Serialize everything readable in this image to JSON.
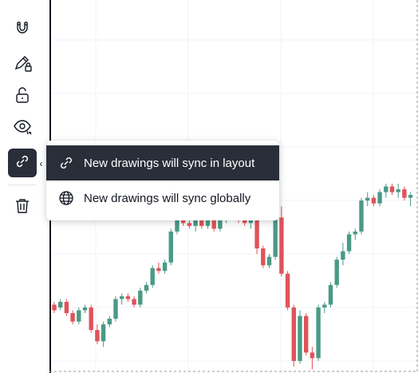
{
  "toolbar": {
    "tools": [
      {
        "name": "magnet-tool",
        "icon": "magnet-icon"
      },
      {
        "name": "lock-drawing-tool",
        "icon": "pencil-lock-icon"
      },
      {
        "name": "lock-all-tool",
        "icon": "unlock-icon"
      },
      {
        "name": "hide-drawings-tool",
        "icon": "eye-icon"
      },
      {
        "name": "sync-drawings-tool",
        "icon": "link-icon",
        "active": true
      },
      {
        "name": "remove-drawings-tool",
        "icon": "trash-icon"
      }
    ],
    "expand_glyph": "‹"
  },
  "sync_menu": {
    "items": [
      {
        "label": "New drawings will sync in layout",
        "icon": "link-icon",
        "selected": true
      },
      {
        "label": "New drawings will sync globally",
        "icon": "globe-icon",
        "selected": false
      }
    ]
  },
  "colors": {
    "up": "#4a9a86",
    "down": "#e0535b",
    "accent_dark": "#2a2e39",
    "grid": "#f0f3fa"
  },
  "chart_data": {
    "type": "candlestick",
    "note_rows": "open, high, low, close in relative price units (higher = up)",
    "candles": [
      [
        52,
        53,
        49,
        50
      ],
      [
        51,
        54,
        50,
        53
      ],
      [
        53,
        54,
        48,
        49
      ],
      [
        49,
        50,
        45,
        46
      ],
      [
        46,
        51,
        45,
        50
      ],
      [
        50,
        52,
        49,
        51
      ],
      [
        51,
        52,
        42,
        43
      ],
      [
        43,
        45,
        38,
        39
      ],
      [
        39,
        46,
        37,
        45
      ],
      [
        45,
        48,
        44,
        47
      ],
      [
        47,
        55,
        46,
        54
      ],
      [
        54,
        56,
        52,
        55
      ],
      [
        55,
        56,
        53,
        54
      ],
      [
        54,
        55,
        51,
        52
      ],
      [
        52,
        58,
        51,
        57
      ],
      [
        57,
        60,
        56,
        59
      ],
      [
        59,
        66,
        58,
        65
      ],
      [
        65,
        67,
        63,
        64
      ],
      [
        64,
        68,
        63,
        67
      ],
      [
        67,
        79,
        66,
        78
      ],
      [
        78,
        84,
        77,
        83
      ],
      [
        83,
        84,
        80,
        81
      ],
      [
        81,
        84,
        79,
        80
      ],
      [
        80,
        83,
        78,
        82
      ],
      [
        82,
        83,
        79,
        80
      ],
      [
        80,
        83,
        79,
        82
      ],
      [
        82,
        83,
        78,
        79
      ],
      [
        79,
        84,
        78,
        83
      ],
      [
        83,
        86,
        81,
        85
      ],
      [
        85,
        85,
        84,
        84
      ],
      [
        84,
        85,
        81,
        82
      ],
      [
        82,
        86,
        80,
        81
      ],
      [
        81,
        86,
        79,
        85
      ],
      [
        85,
        89,
        70,
        72
      ],
      [
        72,
        73,
        65,
        66
      ],
      [
        66,
        70,
        65,
        69
      ],
      [
        69,
        84,
        68,
        83
      ],
      [
        83,
        87,
        62,
        63
      ],
      [
        63,
        64,
        50,
        51
      ],
      [
        51,
        52,
        30,
        32
      ],
      [
        32,
        50,
        31,
        48
      ],
      [
        48,
        49,
        34,
        35
      ],
      [
        35,
        37,
        29,
        33
      ],
      [
        33,
        52,
        32,
        51
      ],
      [
        51,
        53,
        49,
        52
      ],
      [
        52,
        60,
        51,
        59
      ],
      [
        59,
        69,
        58,
        68
      ],
      [
        68,
        74,
        66,
        71
      ],
      [
        71,
        78,
        70,
        77
      ],
      [
        77,
        79,
        75,
        78
      ],
      [
        78,
        90,
        77,
        89
      ],
      [
        89,
        92,
        87,
        90
      ],
      [
        90,
        91,
        87,
        88
      ],
      [
        88,
        93,
        87,
        92
      ],
      [
        92,
        95,
        90,
        94
      ],
      [
        94,
        95,
        91,
        92
      ],
      [
        92,
        95,
        90,
        93
      ],
      [
        93,
        94,
        89,
        90
      ],
      [
        90,
        92,
        87,
        91
      ]
    ]
  }
}
